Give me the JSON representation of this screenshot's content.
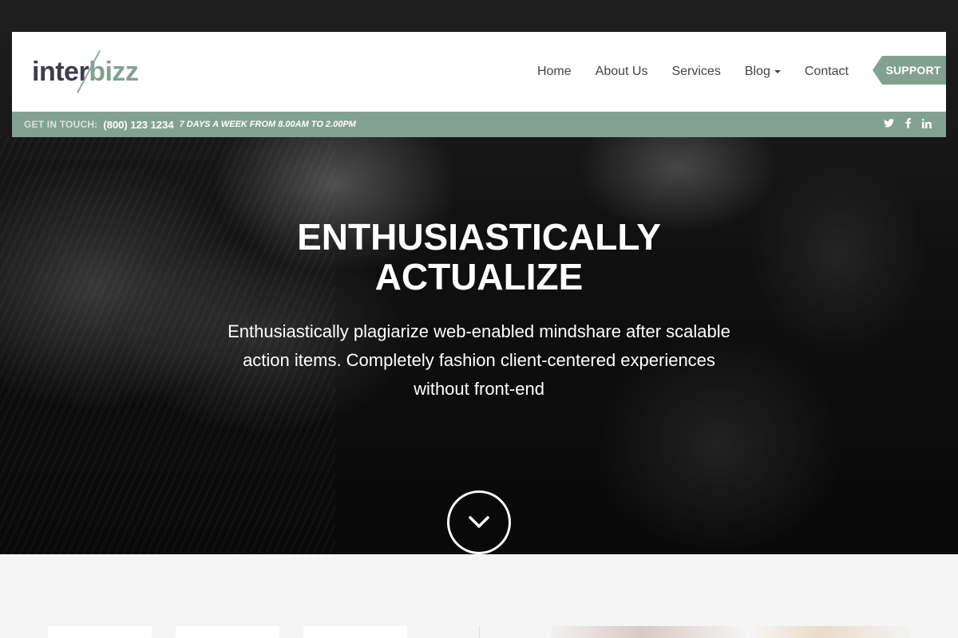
{
  "brand": {
    "logo_part1": "inter",
    "logo_part2": "bizz"
  },
  "nav": {
    "items": [
      {
        "label": "Home"
      },
      {
        "label": "About Us"
      },
      {
        "label": "Services"
      },
      {
        "label": "Blog"
      },
      {
        "label": "Contact"
      }
    ],
    "support_label": "SUPPORT"
  },
  "topbar": {
    "label": "GET IN TOUCH:",
    "phone": "(800) 123 1234",
    "hours": "7 DAYS A WEEK FROM 8.00AM TO 2.00PM",
    "social_icons": [
      "twitter-icon",
      "facebook-icon",
      "linkedin-icon"
    ]
  },
  "hero": {
    "title_line1": "ENTHUSIASTICALLY",
    "title_line2": "ACTUALIZE",
    "subtitle_line1": "Enthusiastically plagiarize web-enabled mindshare after scalable",
    "subtitle_line2": "action items. Completely fashion client-centered experiences",
    "subtitle_line3": "without front-end",
    "scroll_icon": "chevron-down-icon"
  },
  "colors": {
    "accent": "#83a193",
    "logo_dark": "#3f3b4e",
    "nav_text": "#444444",
    "header_bg": "#ffffff",
    "hero_text": "#ffffff"
  }
}
